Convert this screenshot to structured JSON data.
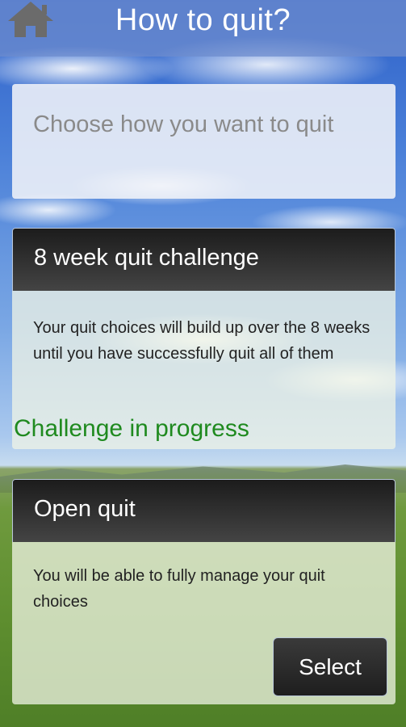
{
  "header": {
    "title": "How to quit?",
    "home_icon": "home-icon"
  },
  "prompt": {
    "text": "Choose how you want to quit"
  },
  "options": [
    {
      "title": "8 week quit challenge",
      "description": "Your quit choices will build up over the 8 weeks until you have successfully quit all of them",
      "status": "Challenge in progress",
      "status_color": "#1f8a1f"
    },
    {
      "title": "Open quit",
      "description": "You will be able to fully manage your quit choices",
      "button_label": "Select"
    }
  ]
}
